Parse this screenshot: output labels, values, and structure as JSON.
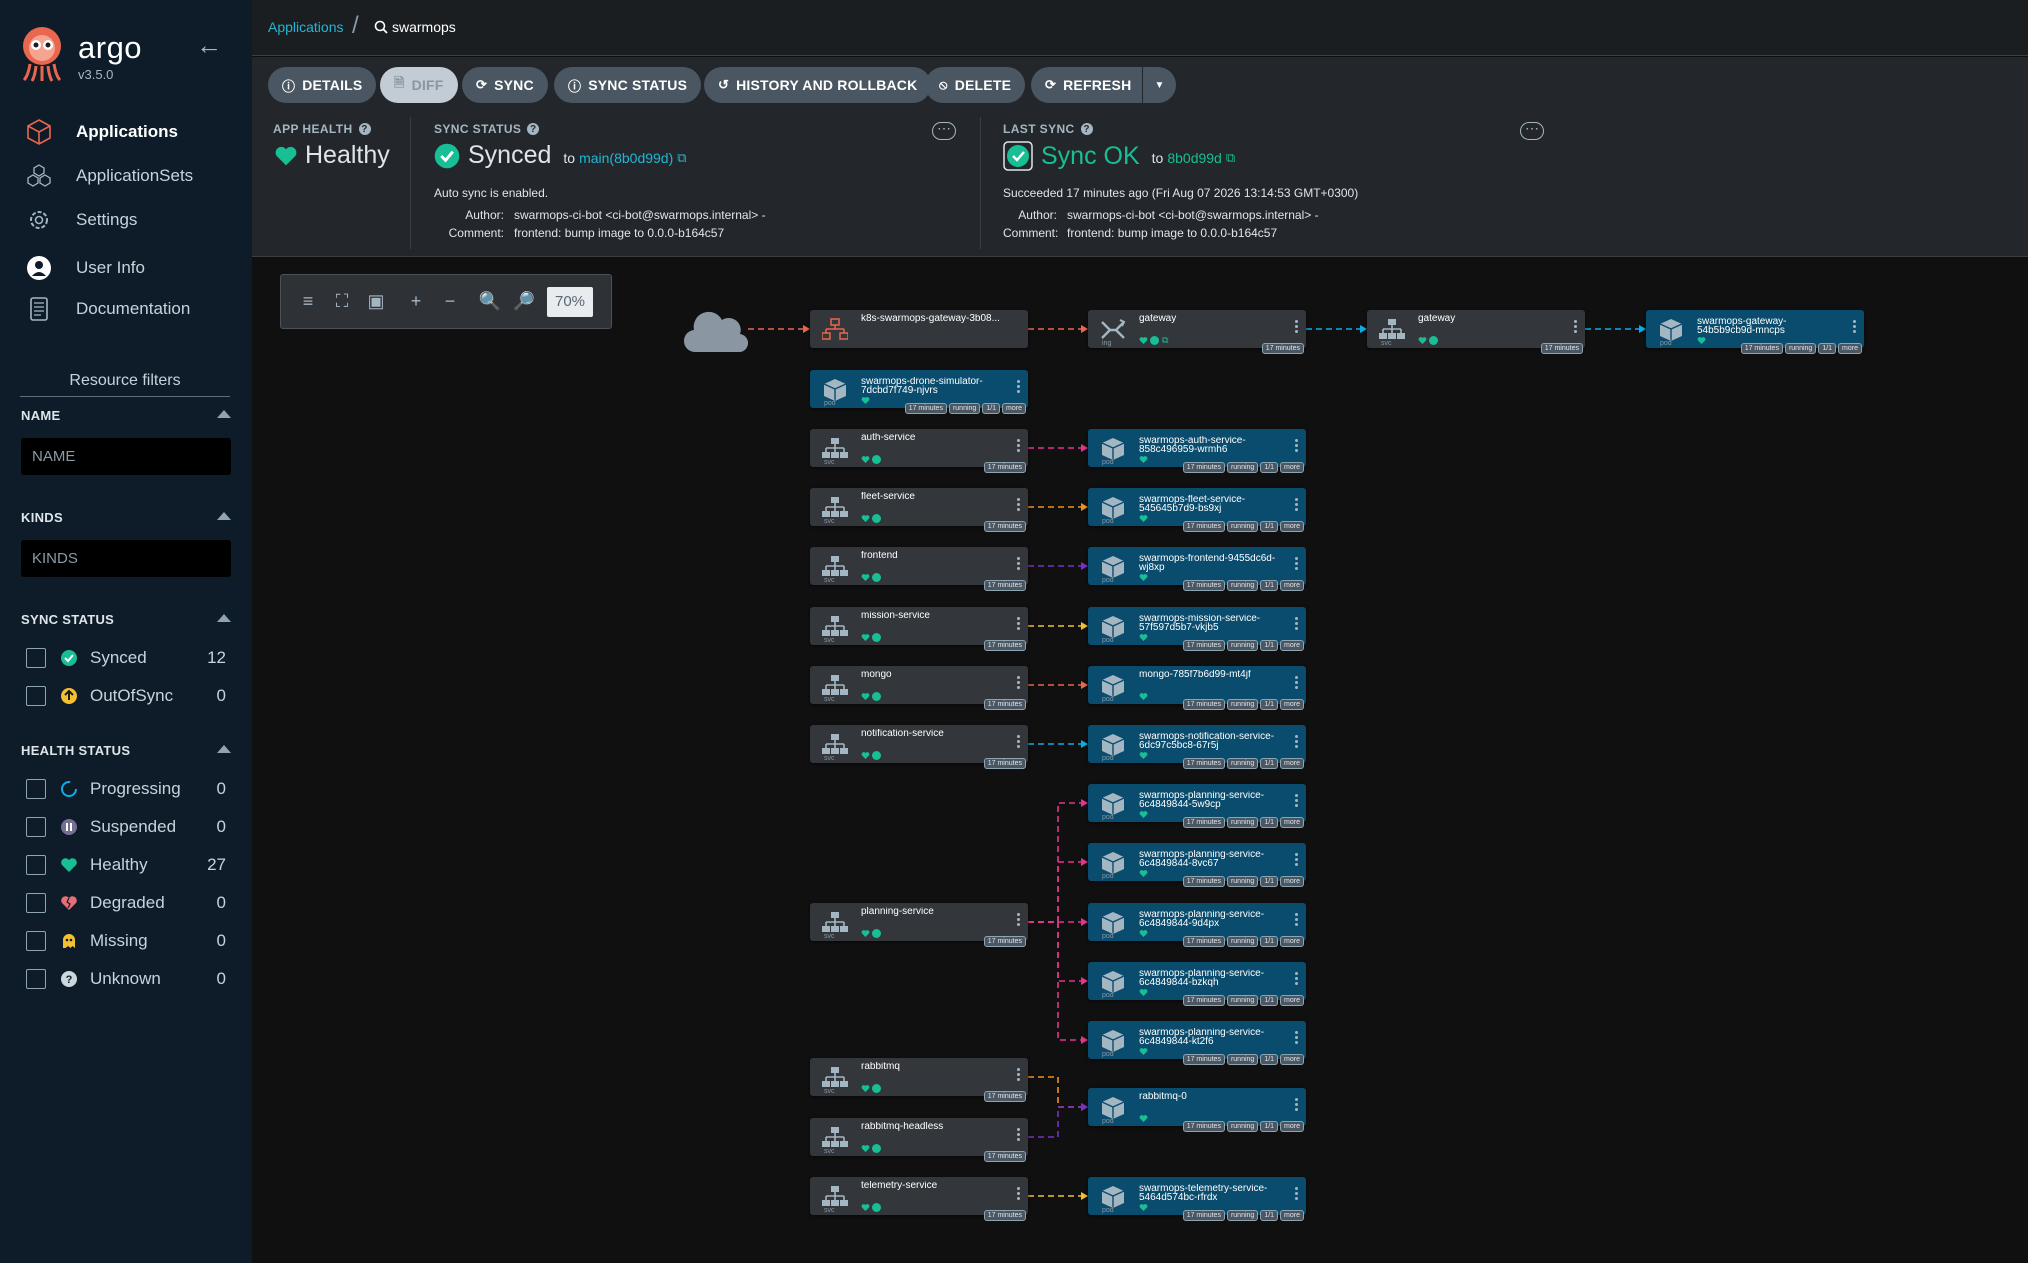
{
  "sidebar": {
    "brand": "argo",
    "version": "v3.5.0",
    "nav": [
      {
        "label": "Applications",
        "icon": "cube-icon",
        "active": true
      },
      {
        "label": "ApplicationSets",
        "icon": "cubes-icon",
        "active": false
      },
      {
        "label": "Settings",
        "icon": "gear-icon",
        "active": false
      },
      {
        "label": "User Info",
        "icon": "user-icon",
        "active": false
      },
      {
        "label": "Documentation",
        "icon": "book-icon",
        "active": false
      }
    ],
    "filters_title": "Resource filters",
    "name_label": "NAME",
    "name_placeholder": "NAME",
    "kinds_label": "KINDS",
    "kinds_placeholder": "KINDS",
    "sync_status_label": "SYNC STATUS",
    "sync_status": [
      {
        "label": "Synced",
        "count": "12",
        "color": "#18be94"
      },
      {
        "label": "OutOfSync",
        "count": "0",
        "color": "#f4c030"
      }
    ],
    "health_status_label": "HEALTH STATUS",
    "health_status": [
      {
        "label": "Progressing",
        "count": "0",
        "color": "#0dadea"
      },
      {
        "label": "Suspended",
        "count": "0",
        "color": "#766f94"
      },
      {
        "label": "Healthy",
        "count": "27",
        "color": "#18be94"
      },
      {
        "label": "Degraded",
        "count": "0",
        "color": "#e96d76"
      },
      {
        "label": "Missing",
        "count": "0",
        "color": "#f4c030"
      },
      {
        "label": "Unknown",
        "count": "0",
        "color": "#ccd6dd"
      }
    ]
  },
  "breadcrumb": {
    "root": "Applications",
    "current": "swarmops"
  },
  "toolbar": {
    "details": "DETAILS",
    "diff": "DIFF",
    "sync": "SYNC",
    "sync_status": "SYNC STATUS",
    "history": "HISTORY AND ROLLBACK",
    "delete": "DELETE",
    "refresh": "REFRESH"
  },
  "status": {
    "app_health_label": "APP HEALTH",
    "app_health": "Healthy",
    "sync_status_label": "SYNC STATUS",
    "sync_status": "Synced",
    "sync_to": "to",
    "sync_rev": "main(8b0d99d)",
    "auto_sync": "Auto sync is enabled.",
    "author_label": "Author:",
    "author": "swarmops-ci-bot <ci-bot@swarmops.internal> -",
    "comment_label": "Comment:",
    "comment": "frontend: bump image to 0.0.0-b164c57",
    "last_sync_label": "LAST SYNC",
    "last_sync": "Sync OK",
    "last_sync_to": "to",
    "last_sync_rev": "8b0d99d",
    "succeeded": "Succeeded 17 minutes ago (Fri Aug 07 2026 13:14:53 GMT+0300)",
    "ls_author": "swarmops-ci-bot <ci-bot@swarmops.internal> -",
    "ls_comment": "frontend: bump image to 0.0.0-b164c57"
  },
  "graph": {
    "zoom": "70%",
    "age": "17 minutes",
    "running": "running",
    "ready": "1/1",
    "more": "more",
    "nodes": {
      "ingress": {
        "name": "k8s-swarmops-gateway-3b08...",
        "kind": ""
      },
      "gw_ing": {
        "name": "gateway",
        "kind": "ing"
      },
      "gw_svc": {
        "name": "gateway",
        "kind": "svc"
      },
      "gw_pod": {
        "name": "swarmops-gateway-\n54b5b9cb9d-mncps",
        "kind": "pod"
      },
      "drone": {
        "name": "swarmops-drone-simulator-\n7dcbd7f749-njvrs",
        "kind": "pod"
      },
      "svc_auth": {
        "name": "auth-service",
        "kind": "svc"
      },
      "pod_auth": {
        "name": "swarmops-auth-service-\n858c496959-wrmh6",
        "kind": "pod"
      },
      "svc_fleet": {
        "name": "fleet-service",
        "kind": "svc"
      },
      "pod_fleet": {
        "name": "swarmops-fleet-service-\n545645b7d9-bs9xj",
        "kind": "pod"
      },
      "svc_frontend": {
        "name": "frontend",
        "kind": "svc"
      },
      "pod_frontend": {
        "name": "swarmops-frontend-9455dc6d-\nwj8xp",
        "kind": "pod"
      },
      "svc_mission": {
        "name": "mission-service",
        "kind": "svc"
      },
      "pod_mission": {
        "name": "swarmops-mission-service-\n57f597d5b7-vkjb5",
        "kind": "pod"
      },
      "svc_mongo": {
        "name": "mongo",
        "kind": "svc"
      },
      "pod_mongo": {
        "name": "mongo-785f7b6d99-mt4jf",
        "kind": "pod"
      },
      "svc_notif": {
        "name": "notification-service",
        "kind": "svc"
      },
      "pod_notif": {
        "name": "swarmops-notification-service-\n6dc97c5bc8-67r5j",
        "kind": "pod"
      },
      "pod_plan1": {
        "name": "swarmops-planning-service-\n6c4849844-5w9cp",
        "kind": "pod"
      },
      "pod_plan2": {
        "name": "swarmops-planning-service-\n6c4849844-8vc67",
        "kind": "pod"
      },
      "svc_plan": {
        "name": "planning-service",
        "kind": "svc"
      },
      "pod_plan3": {
        "name": "swarmops-planning-service-\n6c4849844-9d4px",
        "kind": "pod"
      },
      "pod_plan4": {
        "name": "swarmops-planning-service-\n6c4849844-bzkqh",
        "kind": "pod"
      },
      "pod_plan5": {
        "name": "swarmops-planning-service-\n6c4849844-kt2f6",
        "kind": "pod"
      },
      "svc_rabbit": {
        "name": "rabbitmq",
        "kind": "svc"
      },
      "pod_rabbit": {
        "name": "rabbitmq-0",
        "kind": "pod"
      },
      "svc_rabbit_hl": {
        "name": "rabbitmq-headless",
        "kind": "svc"
      },
      "svc_telemetry": {
        "name": "telemetry-service",
        "kind": "svc"
      },
      "pod_telemetry": {
        "name": "swarmops-telemetry-service-\n5464d574bc-rfrdx",
        "kind": "pod"
      }
    }
  }
}
